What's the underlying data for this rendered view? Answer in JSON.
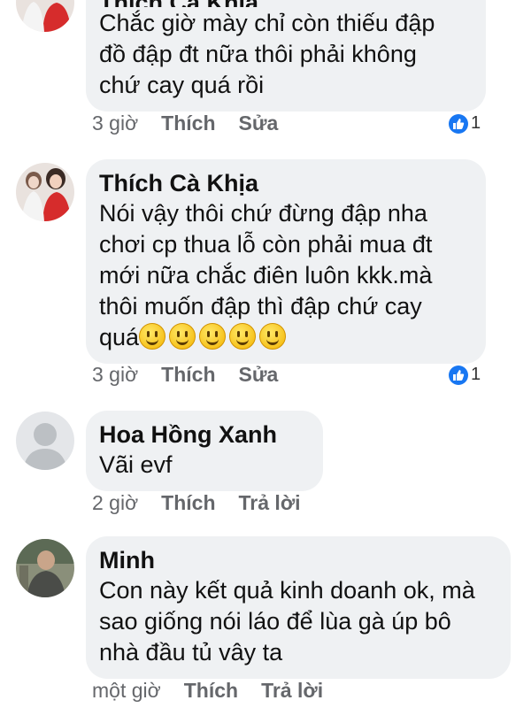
{
  "comments": [
    {
      "author": "Thích Cà Khịa",
      "lines": [
        "Chắc giờ mày chỉ còn thiếu đập",
        "đồ đập đt nữa thôi phải không",
        "chứ cay quá rồi"
      ],
      "time": "3 giờ",
      "like_action": "Thích",
      "second_action": "Sửa",
      "likes": "1",
      "avatar": "photo-woman-red-dress"
    },
    {
      "author": "Thích Cà Khịa",
      "lines": [
        "Nói vậy thôi chứ đừng đập nha",
        "chơi cp thua lỗ còn phải mua đt",
        "mới nữa chắc điên luôn kkk.mà",
        "thôi muốn đập thì đập chứ cay",
        "quá"
      ],
      "emoji_count": 5,
      "emoji": "grinning-face-emoji",
      "time": "3 giờ",
      "like_action": "Thích",
      "second_action": "Sửa",
      "likes": "1",
      "avatar": "photo-woman-red-dress"
    },
    {
      "author": "Hoa Hồng Xanh",
      "lines": [
        "Vãi evf"
      ],
      "time": "2 giờ",
      "like_action": "Thích",
      "second_action": "Trả lời",
      "avatar": "default-silhouette"
    },
    {
      "author": "Minh",
      "lines": [
        "Con này kết quả kinh doanh ok, mà",
        "sao giống nói láo để lùa gà úp bô",
        "nhà đầu tủ vây ta"
      ],
      "time": "một giờ",
      "like_action": "Thích",
      "second_action": "Trả lời",
      "avatar": "photo-man-outdoors"
    }
  ],
  "colors": {
    "bubble": "#eff1f3",
    "meta": "#65676b",
    "like_blue": "#1877f2"
  }
}
